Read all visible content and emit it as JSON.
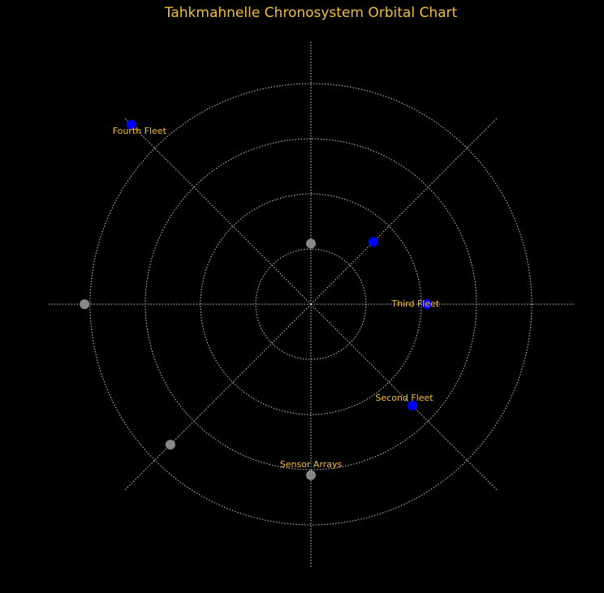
{
  "chart_data": {
    "type": "scatter",
    "subtype": "polar",
    "title": "Tahkmahnelle Chronosystem Orbital Chart",
    "radial_range": [
      0,
      4
    ],
    "rings": [
      1,
      2,
      3,
      4
    ],
    "spokes_deg": [
      0,
      45,
      90,
      135,
      180,
      225,
      270,
      315
    ],
    "grid": true,
    "colors": {
      "background": "#000000",
      "grid": "#cccccc",
      "text": "#f0c030",
      "fleet": "#0000ff",
      "installation": "#888888"
    },
    "points": [
      {
        "label": "Fourth Fleet",
        "angle_deg": 135,
        "radius": 4.6,
        "group": "fleet"
      },
      {
        "label": "",
        "angle_deg": 45,
        "radius": 1.6,
        "group": "fleet"
      },
      {
        "label": "Third Fleet",
        "angle_deg": 0,
        "radius": 2.1,
        "group": "fleet"
      },
      {
        "label": "Second Fleet",
        "angle_deg": 315,
        "radius": 2.6,
        "group": "fleet"
      },
      {
        "label": "",
        "angle_deg": 90,
        "radius": 1.1,
        "group": "installation"
      },
      {
        "label": "",
        "angle_deg": 180,
        "radius": 4.1,
        "group": "installation"
      },
      {
        "label": "",
        "angle_deg": 225,
        "radius": 3.6,
        "group": "installation"
      },
      {
        "label": "Sensor Arrays",
        "angle_deg": 270,
        "radius": 3.1,
        "group": "installation"
      }
    ]
  }
}
